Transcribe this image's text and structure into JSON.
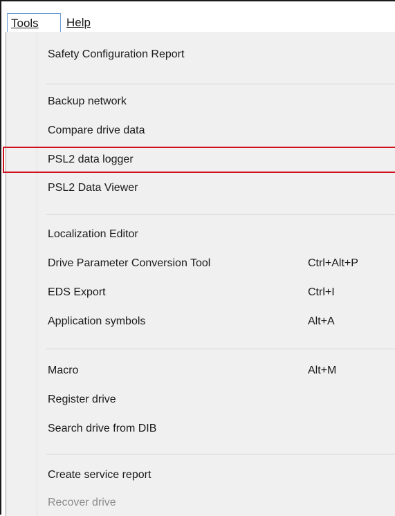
{
  "menubar": {
    "tools_label": "Tools",
    "help_label": "Help"
  },
  "tools_menu": {
    "items": [
      {
        "label": "Safety Configuration Report",
        "shortcut": ""
      },
      {
        "label": "Backup network",
        "shortcut": ""
      },
      {
        "label": "Compare drive data",
        "shortcut": ""
      },
      {
        "label": "PSL2 data logger",
        "shortcut": "",
        "highlighted": true
      },
      {
        "label": "PSL2 Data Viewer",
        "shortcut": ""
      },
      {
        "label": "Localization Editor",
        "shortcut": ""
      },
      {
        "label": "Drive Parameter Conversion Tool",
        "shortcut": "Ctrl+Alt+P"
      },
      {
        "label": "EDS Export",
        "shortcut": "Ctrl+I"
      },
      {
        "label": "Application symbols",
        "shortcut": "Alt+A"
      },
      {
        "label": "Macro",
        "shortcut": "Alt+M"
      },
      {
        "label": "Register drive",
        "shortcut": ""
      },
      {
        "label": "Search drive from DIB",
        "shortcut": ""
      },
      {
        "label": "Create service report",
        "shortcut": ""
      },
      {
        "label": "Recover drive",
        "shortcut": "",
        "disabled": true
      }
    ]
  },
  "colors": {
    "highlight_border": "#d0101c",
    "menu_background": "#f0f0f0",
    "disabled_text": "#8c8c8c",
    "active_menubar_border": "#6a9fd4"
  }
}
